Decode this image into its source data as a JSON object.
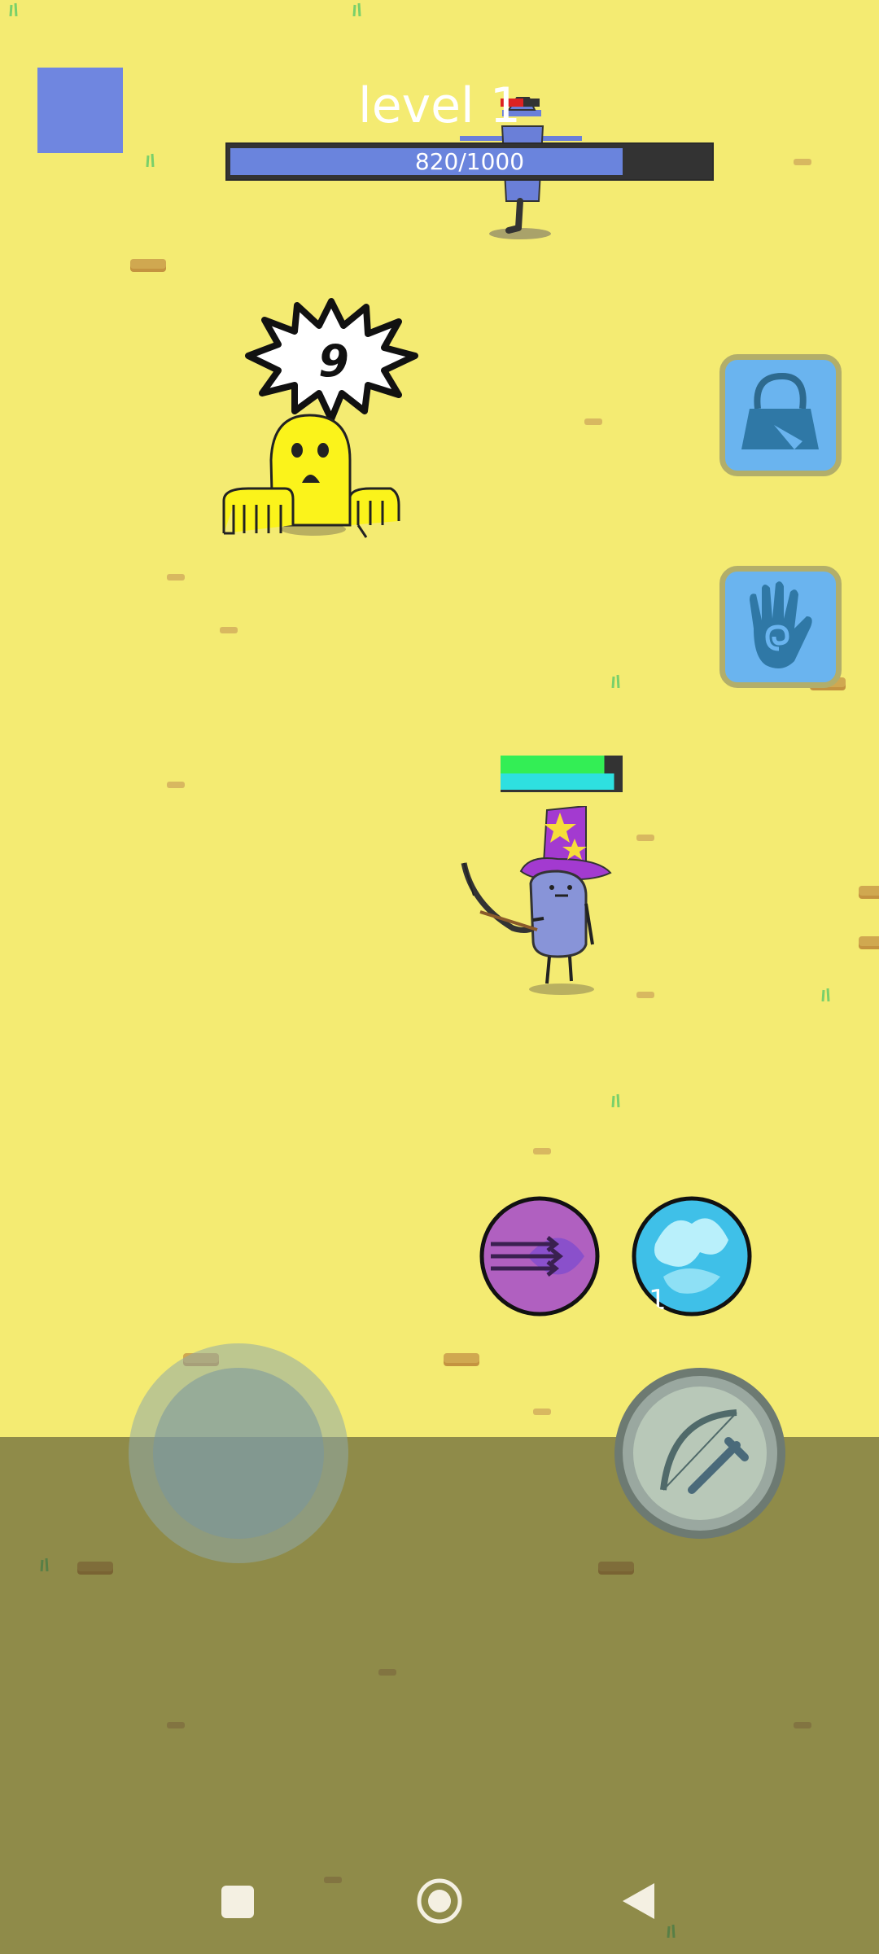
{
  "hud": {
    "level_label": "level 1",
    "xp_text": "820/1000",
    "xp_progress": 0.82
  },
  "enemy": {
    "damage_popup": "9"
  },
  "player": {
    "health_fraction": 0.85,
    "mana_fraction": 0.93
  },
  "skills": {
    "cooldown_label": "1"
  },
  "icons": {
    "menu": "menu-square-icon",
    "bag": "bag-icon",
    "spell_hand": "spiral-hand-icon",
    "dash": "arrow-dash-icon",
    "water": "water-orb-icon",
    "attack": "bow-sword-icon",
    "nav_recents": "square-icon",
    "nav_home": "circle-icon",
    "nav_back": "triangle-back-icon"
  },
  "colors": {
    "ground": "#f4eb72",
    "xp_fill": "#6a84dd",
    "side_button": "#6ab4ef",
    "health": "#33ee55",
    "mana": "#2ee0e0"
  }
}
